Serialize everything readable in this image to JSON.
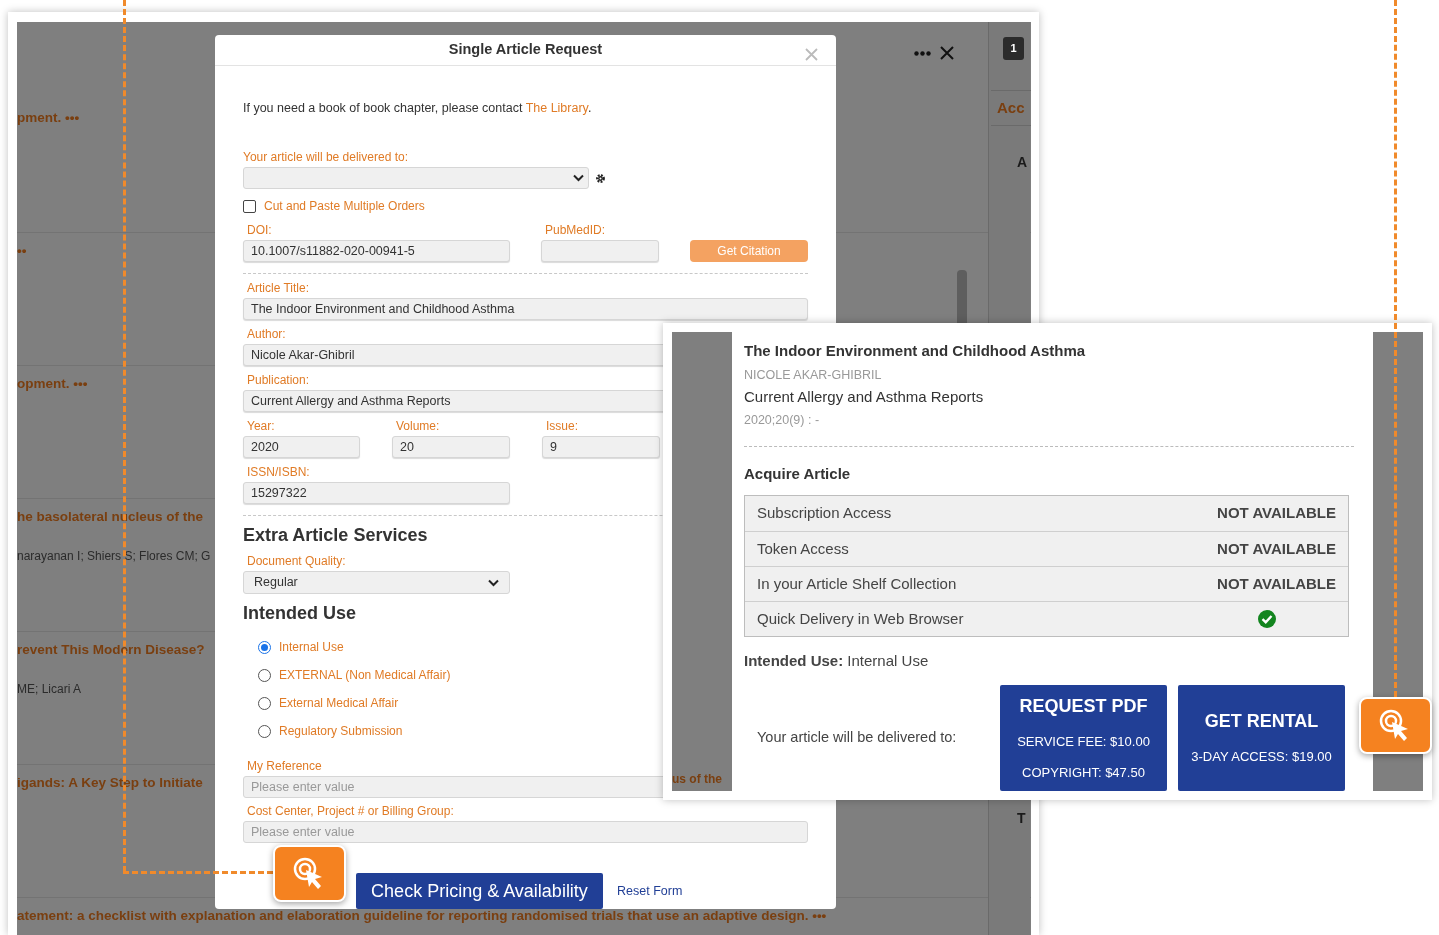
{
  "background_page": {
    "badge": "1",
    "tab": "Acc",
    "letters": [
      "A",
      "T"
    ],
    "peek_text": "us of the",
    "results": [
      {
        "title": "pment. •••"
      },
      {
        "title": "••"
      },
      {
        "title": "opment. •••"
      },
      {
        "title": "he basolateral nucleus of the",
        "authors": "narayanan I; Shiers S; Flores CM; G"
      },
      {
        "title": "revent This Modern Disease?",
        "authors": "ME; Licari A"
      },
      {
        "title": "igands: A Key Step to Initiate"
      },
      {
        "title": "atement: a checklist with explanation and elaboration guideline for reporting randomised trials that use an adaptive design. •••"
      }
    ]
  },
  "modal": {
    "title": "Single Article Request",
    "intro": {
      "text": "If you need a book of book chapter, please contact ",
      "link": "The Library",
      "end": "."
    },
    "delivery_label": "Your article will be delivered to:",
    "cut_paste": {
      "label": "Cut and Paste Multiple Orders",
      "checked": false
    },
    "doi": {
      "label": "DOI:",
      "value": "10.1007/s11882-020-00941-5"
    },
    "pubmed": {
      "label": "PubMedID:"
    },
    "get_citation": "Get Citation",
    "article_title": {
      "label": "Article Title:",
      "value": "The Indoor Environment and Childhood Asthma"
    },
    "author": {
      "label": "Author:",
      "value": "Nicole Akar-Ghibril"
    },
    "publication": {
      "label": "Publication:",
      "value": "Current Allergy and Asthma Reports"
    },
    "year": {
      "label": "Year:",
      "value": "2020"
    },
    "volume": {
      "label": "Volume:",
      "value": "20"
    },
    "issue": {
      "label": "Issue:",
      "value": "9"
    },
    "issn": {
      "label": "ISSN/ISBN:",
      "value": "15297322"
    },
    "extra_heading": "Extra Article Services",
    "quality": {
      "label": "Document Quality:",
      "value": "Regular"
    },
    "intended_heading": "Intended Use",
    "radios": [
      {
        "label": "Internal Use",
        "selected": true
      },
      {
        "label": "EXTERNAL (Non Medical Affair)",
        "selected": false
      },
      {
        "label": "External Medical Affair",
        "selected": false
      },
      {
        "label": "Regulatory Submission",
        "selected": false
      }
    ],
    "my_reference": {
      "label": "My Reference",
      "placeholder": "Please enter value"
    },
    "cost_center": {
      "label": "Cost Center, Project # or Billing Group:",
      "placeholder": "Please enter value"
    },
    "check_button": "Check Pricing & Availability",
    "reset": "Reset Form"
  },
  "result_card": {
    "title": "The Indoor Environment and Childhood Asthma",
    "author": "NICOLE AKAR-GHIBRIL",
    "journal": "Current Allergy and Asthma Reports",
    "citation": "2020;20(9) : -",
    "acquire_heading": "Acquire Article",
    "options": [
      {
        "label": "Subscription Access",
        "kind": "text",
        "status": "NOT AVAILABLE"
      },
      {
        "label": "Token Access",
        "kind": "text",
        "status": "NOT AVAILABLE"
      },
      {
        "label": "In your Article Shelf Collection",
        "kind": "text",
        "status": "NOT AVAILABLE"
      },
      {
        "label": "Quick Delivery in Web Browser",
        "kind": "check"
      }
    ],
    "intended_use": "**Intended Use:** Internal Use",
    "delivered_label": "Your article will be delivered to:",
    "buttons": [
      {
        "title": "REQUEST PDF",
        "lines": [
          "SERVICE FEE: $10.00",
          "COPYRIGHT: $47.50"
        ]
      },
      {
        "title": "GET RENTAL",
        "lines": [
          "3-DAY ACCESS: $19.00"
        ]
      }
    ]
  }
}
